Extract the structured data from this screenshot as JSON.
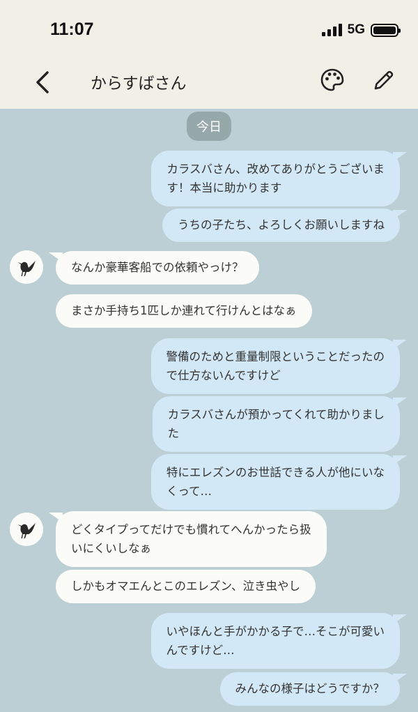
{
  "status_bar": {
    "time": "11:07",
    "network": "5G"
  },
  "header": {
    "title": "からすばさん"
  },
  "icons": {
    "back": "chevron-left-icon",
    "palette": "palette-icon",
    "edit": "pencil-icon",
    "avatar": "crow-icon"
  },
  "date_label": "今日",
  "messages": [
    {
      "sender": "me",
      "text": "カラスバさん、改めてありがとうございま\nす！本当に助かります"
    },
    {
      "sender": "me",
      "text": "うちの子たち、よろしくお願いしますね"
    },
    {
      "sender": "other",
      "text": "なんか豪華客船での依頼やっけ？"
    },
    {
      "sender": "other",
      "text": "まさか手持ち1匹しか連れて行けんとはなぁ"
    },
    {
      "sender": "me",
      "text": "警備のためと重量制限ということだったの\nで仕方ないんですけど"
    },
    {
      "sender": "me",
      "text": "カラスバさんが預かってくれて助かりまし\nた"
    },
    {
      "sender": "me",
      "text": "特にエレズンのお世話できる人が他にいな\nくって…"
    },
    {
      "sender": "other",
      "text": "どくタイプってだけでも慣れてへんかったら扱\nいにくいしなぁ"
    },
    {
      "sender": "other",
      "text": "しかもオマエんとこのエレズン、泣き虫やし"
    },
    {
      "sender": "me",
      "text": "いやほんと手がかかる子で…そこが可愛い\nんですけど…"
    },
    {
      "sender": "me",
      "text": "みんなの様子はどうですか？"
    }
  ],
  "colors": {
    "chat_bg": "#bccfd4",
    "header_bg": "#f1f0e7",
    "sent_bubble": "#d3e8f7",
    "received_bubble": "#fbfbf8"
  }
}
